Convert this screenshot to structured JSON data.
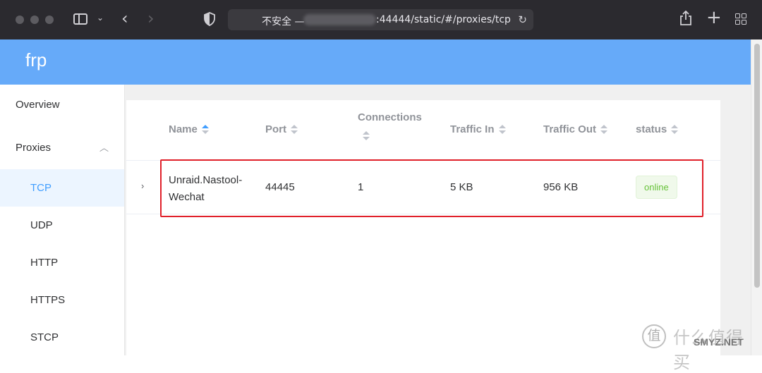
{
  "browser": {
    "url_prefix": "不安全 —",
    "url_path": ":44444/static/#/proxies/tcp"
  },
  "app": {
    "brand": "frp"
  },
  "sidebar": {
    "overview": "Overview",
    "proxies": "Proxies",
    "items": [
      {
        "label": "TCP",
        "active": true
      },
      {
        "label": "UDP"
      },
      {
        "label": "HTTP"
      },
      {
        "label": "HTTPS"
      },
      {
        "label": "STCP"
      }
    ]
  },
  "table": {
    "columns": [
      "Name",
      "Port",
      "Connections",
      "Traffic In",
      "Traffic Out",
      "status"
    ],
    "sorted_column": "Name",
    "rows": [
      {
        "name": "Unraid.Nastool-Wechat",
        "port": "44445",
        "connections": "1",
        "traffic_in": "5 KB",
        "traffic_out": "956 KB",
        "status": "online"
      }
    ]
  },
  "colors": {
    "header": "#66aaf9",
    "active": "#409eff",
    "status_online": "#67c23a",
    "highlight": "#e0202a"
  },
  "watermark": {
    "badge": "值",
    "text": "什么值得买",
    "sub": "SMYZ.NET"
  }
}
